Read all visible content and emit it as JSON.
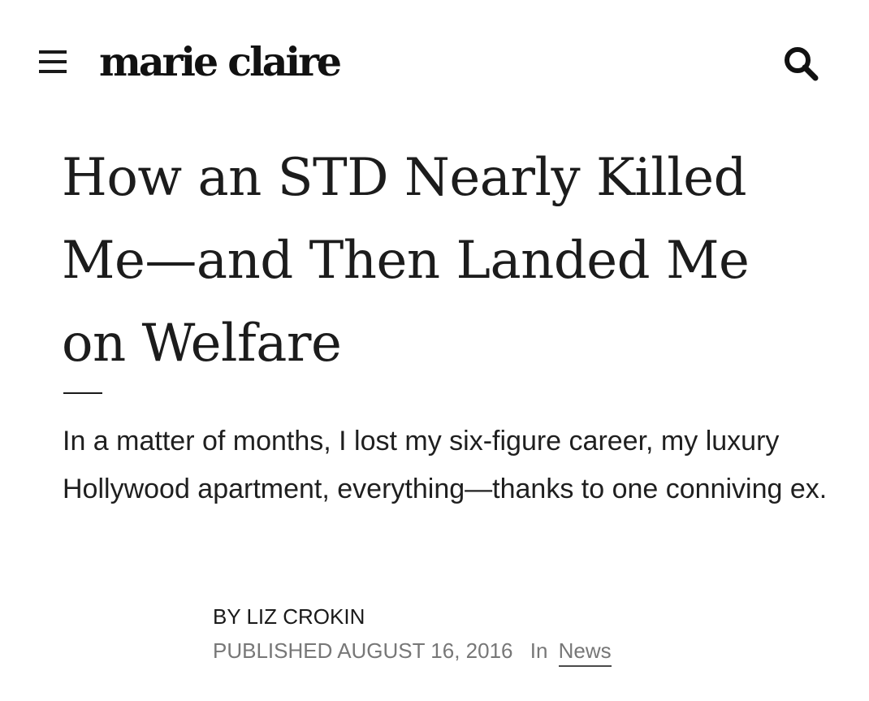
{
  "header": {
    "menu_icon": "hamburger-menu-icon",
    "logo_text": "marie claire",
    "search_icon": "search-icon"
  },
  "article": {
    "headline": "How an STD Nearly Killed Me—and Then Landed Me on Welfare",
    "dek": "In a matter of months, I lost my six-figure career, my luxury Hollywood apartment, everything—thanks to one conniving ex.",
    "byline_prefix": "By",
    "author": "Liz Crokin",
    "published_label": "Published",
    "published_date": "August 16, 2016",
    "in_label": "In",
    "category": "News"
  },
  "colors": {
    "text": "#1a1a1a",
    "meta": "#777777",
    "background": "#ffffff"
  }
}
